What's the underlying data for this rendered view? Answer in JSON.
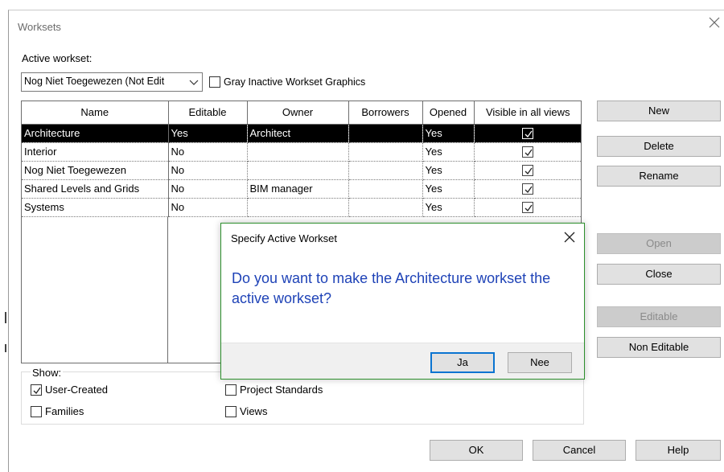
{
  "dialog": {
    "title": "Worksets",
    "active_workset_label": "Active workset:",
    "active_workset_value": "Nog Niet Toegewezen (Not Edit",
    "gray_inactive_label": "Gray Inactive Workset Graphics",
    "gray_inactive_checked": false
  },
  "table": {
    "columns": [
      "Name",
      "Editable",
      "Owner",
      "Borrowers",
      "Opened",
      "Visible in all views"
    ],
    "rows": [
      {
        "name": "Architecture",
        "editable": "Yes",
        "owner": "Architect",
        "borrowers": "",
        "opened": "Yes",
        "visible": true,
        "selected": true
      },
      {
        "name": "Interior",
        "editable": "No",
        "owner": "",
        "borrowers": "",
        "opened": "Yes",
        "visible": true,
        "selected": false
      },
      {
        "name": "Nog Niet Toegewezen",
        "editable": "No",
        "owner": "",
        "borrowers": "",
        "opened": "Yes",
        "visible": true,
        "selected": false
      },
      {
        "name": "Shared Levels and Grids",
        "editable": "No",
        "owner": "BIM manager",
        "borrowers": "",
        "opened": "Yes",
        "visible": true,
        "selected": false
      },
      {
        "name": "Systems",
        "editable": "No",
        "owner": "",
        "borrowers": "",
        "opened": "Yes",
        "visible": true,
        "selected": false
      }
    ]
  },
  "side_buttons": {
    "new": "New",
    "delete": "Delete",
    "rename": "Rename",
    "open": "Open",
    "close": "Close",
    "editable": "Editable",
    "non_editable": "Non Editable"
  },
  "show": {
    "label": "Show:",
    "user_created": "User-Created",
    "user_created_checked": true,
    "families": "Families",
    "families_checked": false,
    "project_standards": "Project Standards",
    "project_standards_checked": false,
    "views": "Views",
    "views_checked": false
  },
  "footer_buttons": {
    "ok": "OK",
    "cancel": "Cancel",
    "help": "Help"
  },
  "modal": {
    "title": "Specify Active Workset",
    "message": "Do you want to make the Architecture workset the active workset?",
    "yes": "Ja",
    "no": "Nee"
  },
  "colors": {
    "modal_message": "#1f43b7",
    "modal_border": "#2c8f2c",
    "default_button_border": "#0a74d1",
    "selected_row_bg": "#000000"
  }
}
